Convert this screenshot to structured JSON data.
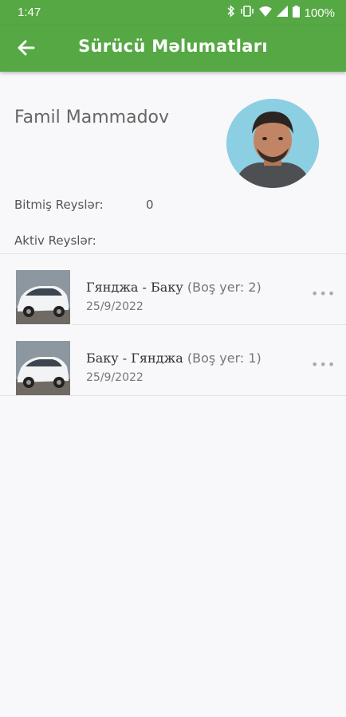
{
  "status": {
    "time": "1:47",
    "battery": "100%"
  },
  "header": {
    "title": "Sürücü Məlumatları"
  },
  "driver": {
    "name": "Famil Mammadov"
  },
  "stats": {
    "completed_label": "Bitmiş Reyslər:",
    "completed_value": "0",
    "active_label": "Aktiv Reyslər:"
  },
  "trips": [
    {
      "route": "Гянджа - Баку",
      "seats": "(Boş yer: 2)",
      "date": "25/9/2022"
    },
    {
      "route": "Баку - Гянджа",
      "seats": "(Boş yer: 1)",
      "date": "25/9/2022"
    }
  ],
  "colors": {
    "primary": "#55a844",
    "background": "#f8f7f9"
  },
  "icons": {
    "back": "arrow-left-icon",
    "more": "more-horizontal-icon"
  }
}
